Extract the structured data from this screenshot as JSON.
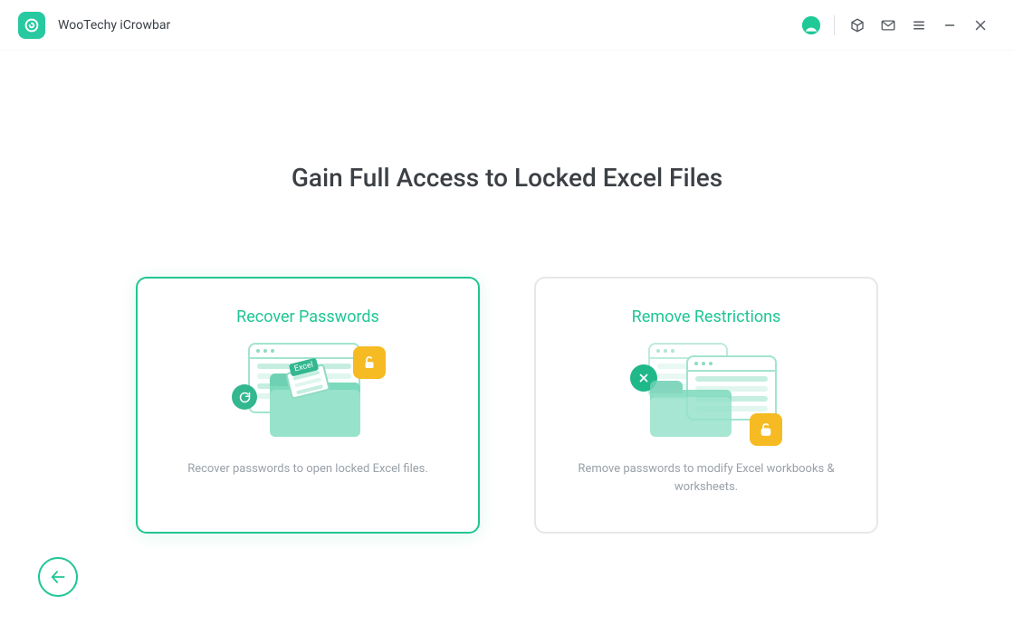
{
  "app": {
    "title": "WooTechy iCrowbar"
  },
  "heading": "Gain Full Access to Locked Excel Files",
  "cards": {
    "recover": {
      "title": "Recover Passwords",
      "desc": "Recover passwords to open locked Excel files.",
      "tag": "Excel"
    },
    "remove": {
      "title": "Remove Restrictions",
      "desc": "Remove passwords to modify Excel workbooks & worksheets."
    }
  }
}
